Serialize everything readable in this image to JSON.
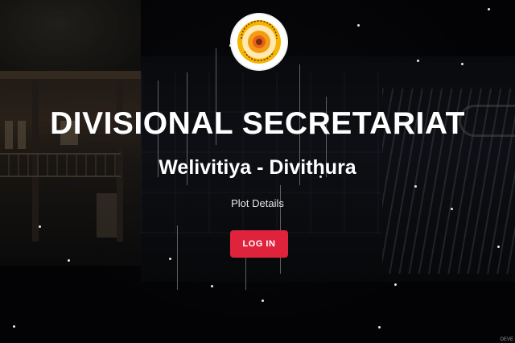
{
  "hero": {
    "title": "DIVISIONAL SECRETARIAT",
    "subtitle": "Welivitiya - Divithura",
    "tagline": "Plot Details",
    "login_label": "LOG IN"
  },
  "logo": {
    "icon": "government-emblem-icon",
    "colors": {
      "ring": "#f4b400",
      "center": "#e8611a",
      "border": "#ffffff"
    }
  },
  "colors": {
    "accent": "#e0233c",
    "text": "#ffffff",
    "background": "#050507"
  },
  "corner_mark": "DEVE"
}
